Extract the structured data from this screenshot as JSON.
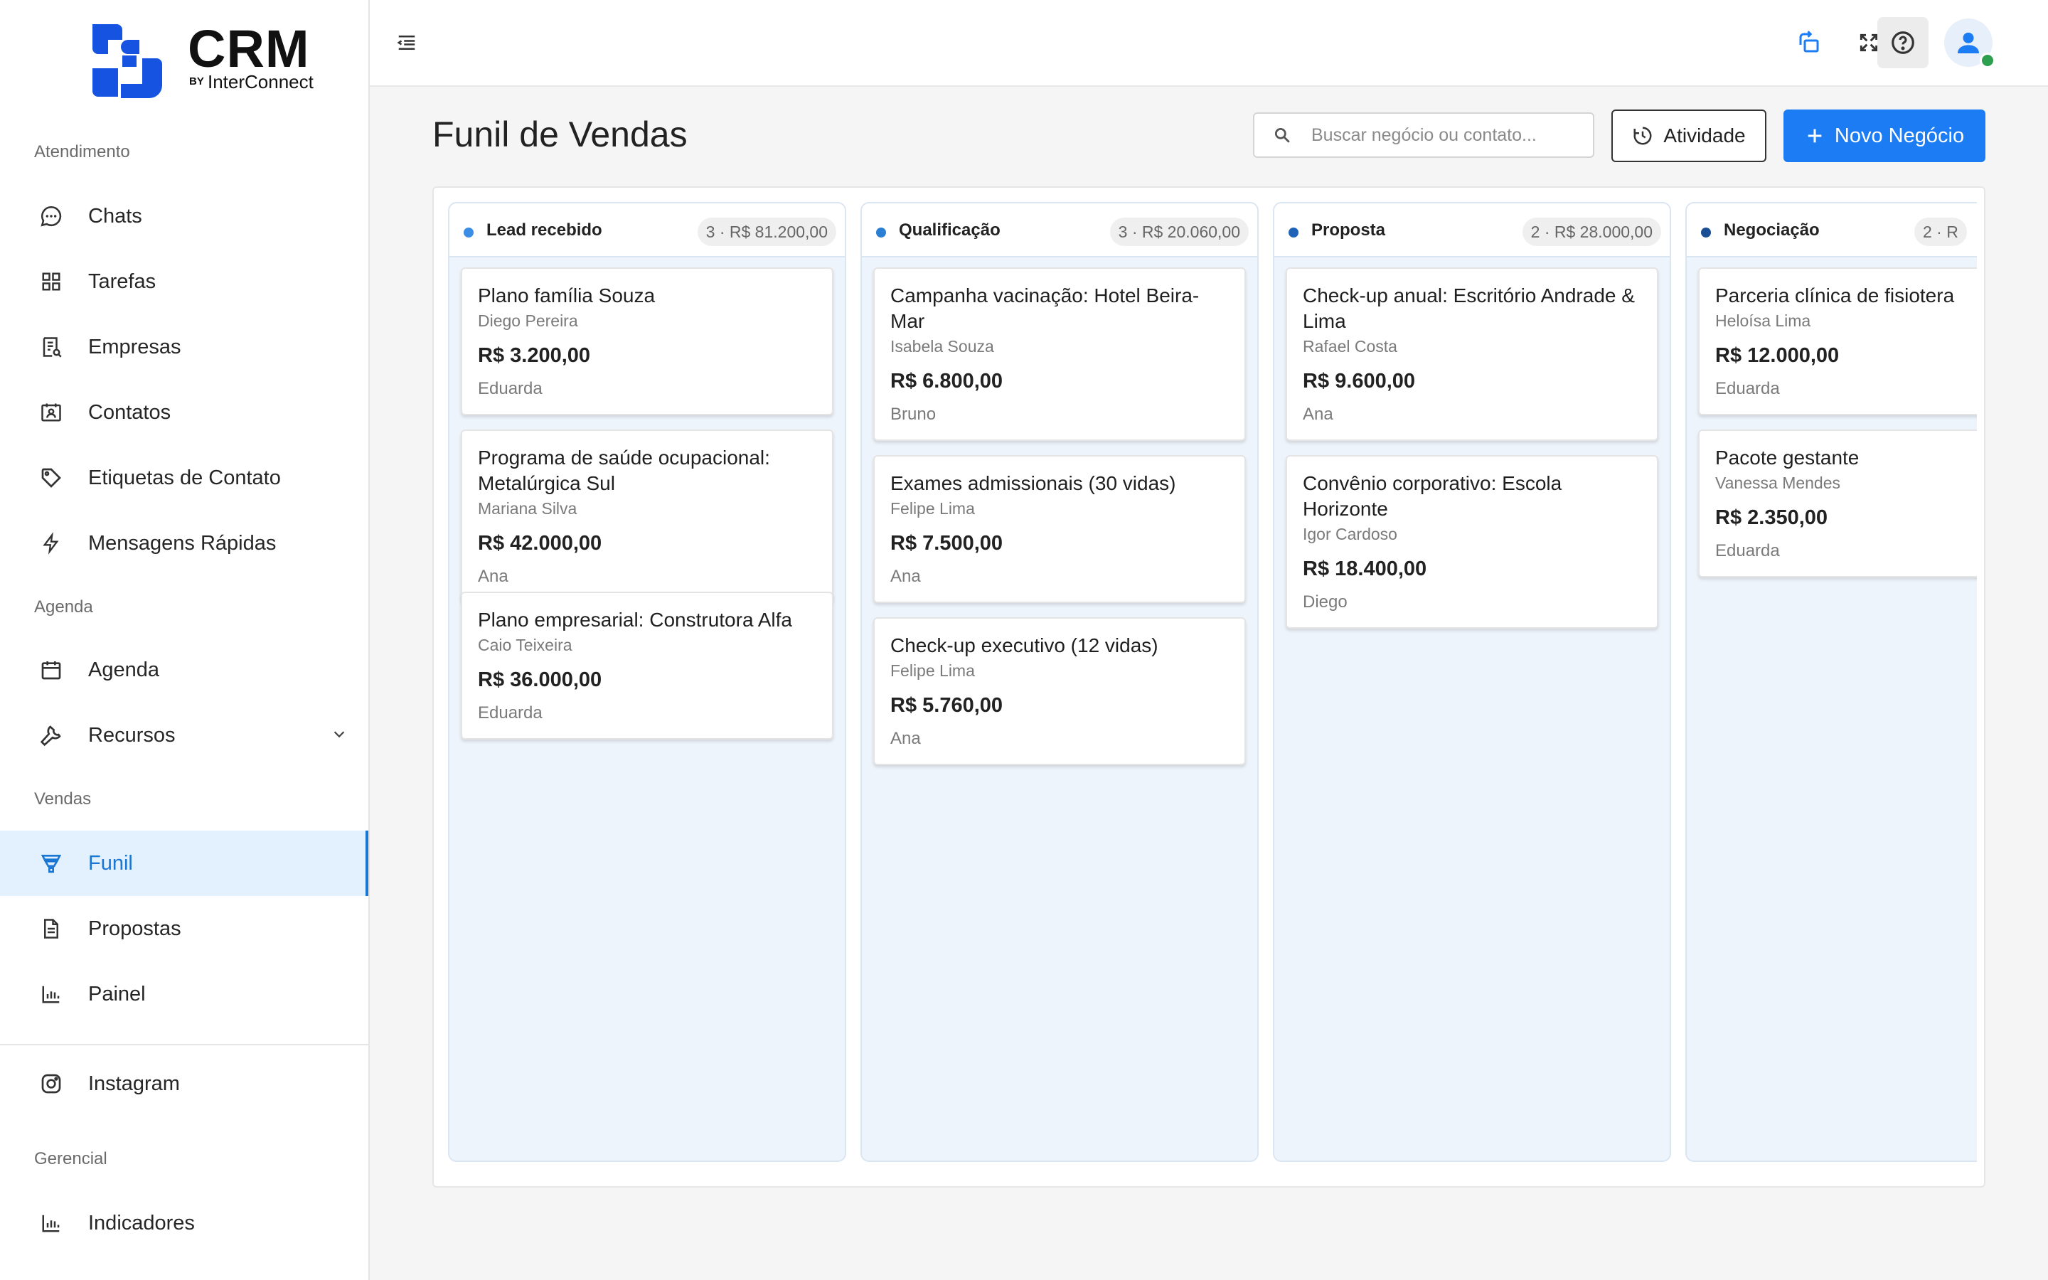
{
  "brand": {
    "title": "CRM",
    "by": "BY",
    "subtitle": "InterConnect"
  },
  "sidebar": {
    "sections": [
      {
        "label": "Atendimento"
      },
      {
        "label": "Agenda"
      },
      {
        "label": "Vendas"
      },
      {
        "label": "Gerencial"
      }
    ],
    "items": [
      {
        "label": "Chats",
        "icon": "chat-icon"
      },
      {
        "label": "Tarefas",
        "icon": "grid-icon"
      },
      {
        "label": "Empresas",
        "icon": "company-icon"
      },
      {
        "label": "Contatos",
        "icon": "contacts-icon"
      },
      {
        "label": "Etiquetas de Contato",
        "icon": "tag-icon"
      },
      {
        "label": "Mensagens Rápidas",
        "icon": "bolt-icon"
      },
      {
        "label": "Agenda",
        "icon": "calendar-icon"
      },
      {
        "label": "Recursos",
        "icon": "wrench-icon"
      },
      {
        "label": "Funil",
        "icon": "funnel-icon",
        "active": true
      },
      {
        "label": "Propostas",
        "icon": "document-icon"
      },
      {
        "label": "Painel",
        "icon": "bar-chart-icon"
      },
      {
        "label": "Instagram",
        "icon": "instagram-icon"
      },
      {
        "label": "Indicadores",
        "icon": "bar-chart-icon"
      }
    ]
  },
  "header": {
    "title": "Funil de Vendas",
    "search_placeholder": "Buscar negócio ou contato...",
    "activity_label": "Atividade",
    "new_deal_label": "Novo Negócio"
  },
  "colors": {
    "accent": "#1c7cf4",
    "active_bg": "#e3f0fd",
    "column_bg": "#eef4fb"
  },
  "board": {
    "columns": [
      {
        "title": "Lead recebido",
        "count": "3 · R$ 81.200,00",
        "dot": "#3a8ee6",
        "cards": [
          {
            "title": "Plano família Souza",
            "contact": "Diego Pereira",
            "value": "R$ 3.200,00",
            "owner": "Eduarda"
          },
          {
            "title": "Programa de saúde ocupacional: Metalúrgica Sul",
            "contact": "Mariana Silva",
            "value": "R$ 42.000,00",
            "owner": "Ana"
          },
          {
            "title": "Plano empresarial: Construtora Alfa",
            "contact": "Caio Teixeira",
            "value": "R$ 36.000,00",
            "owner": "Eduarda"
          }
        ]
      },
      {
        "title": "Qualificação",
        "count": "3 · R$ 20.060,00",
        "dot": "#2a7fd4",
        "cards": [
          {
            "title": "Campanha vacinação: Hotel Beira-Mar",
            "contact": "Isabela Souza",
            "value": "R$ 6.800,00",
            "owner": "Bruno"
          },
          {
            "title": "Exames admissionais (30 vidas)",
            "contact": "Felipe Lima",
            "value": "R$ 7.500,00",
            "owner": "Ana"
          },
          {
            "title": "Check-up executivo (12 vidas)",
            "contact": "Felipe Lima",
            "value": "R$ 5.760,00",
            "owner": "Ana"
          }
        ]
      },
      {
        "title": "Proposta",
        "count": "2 · R$ 28.000,00",
        "dot": "#1f63b8",
        "cards": [
          {
            "title": "Check-up anual: Escritório Andrade & Lima",
            "contact": "Rafael Costa",
            "value": "R$ 9.600,00",
            "owner": "Ana"
          },
          {
            "title": "Convênio corporativo: Escola Horizonte",
            "contact": "Igor Cardoso",
            "value": "R$ 18.400,00",
            "owner": "Diego"
          }
        ]
      },
      {
        "title": "Negociação",
        "count": "2 · R",
        "dot": "#1a4f96",
        "cards": [
          {
            "title": "Parceria clínica de fisiotera",
            "contact": "Heloísa Lima",
            "value": "R$ 12.000,00",
            "owner": "Eduarda"
          },
          {
            "title": "Pacote gestante",
            "contact": "Vanessa Mendes",
            "value": "R$ 2.350,00",
            "owner": "Eduarda"
          }
        ]
      }
    ]
  }
}
